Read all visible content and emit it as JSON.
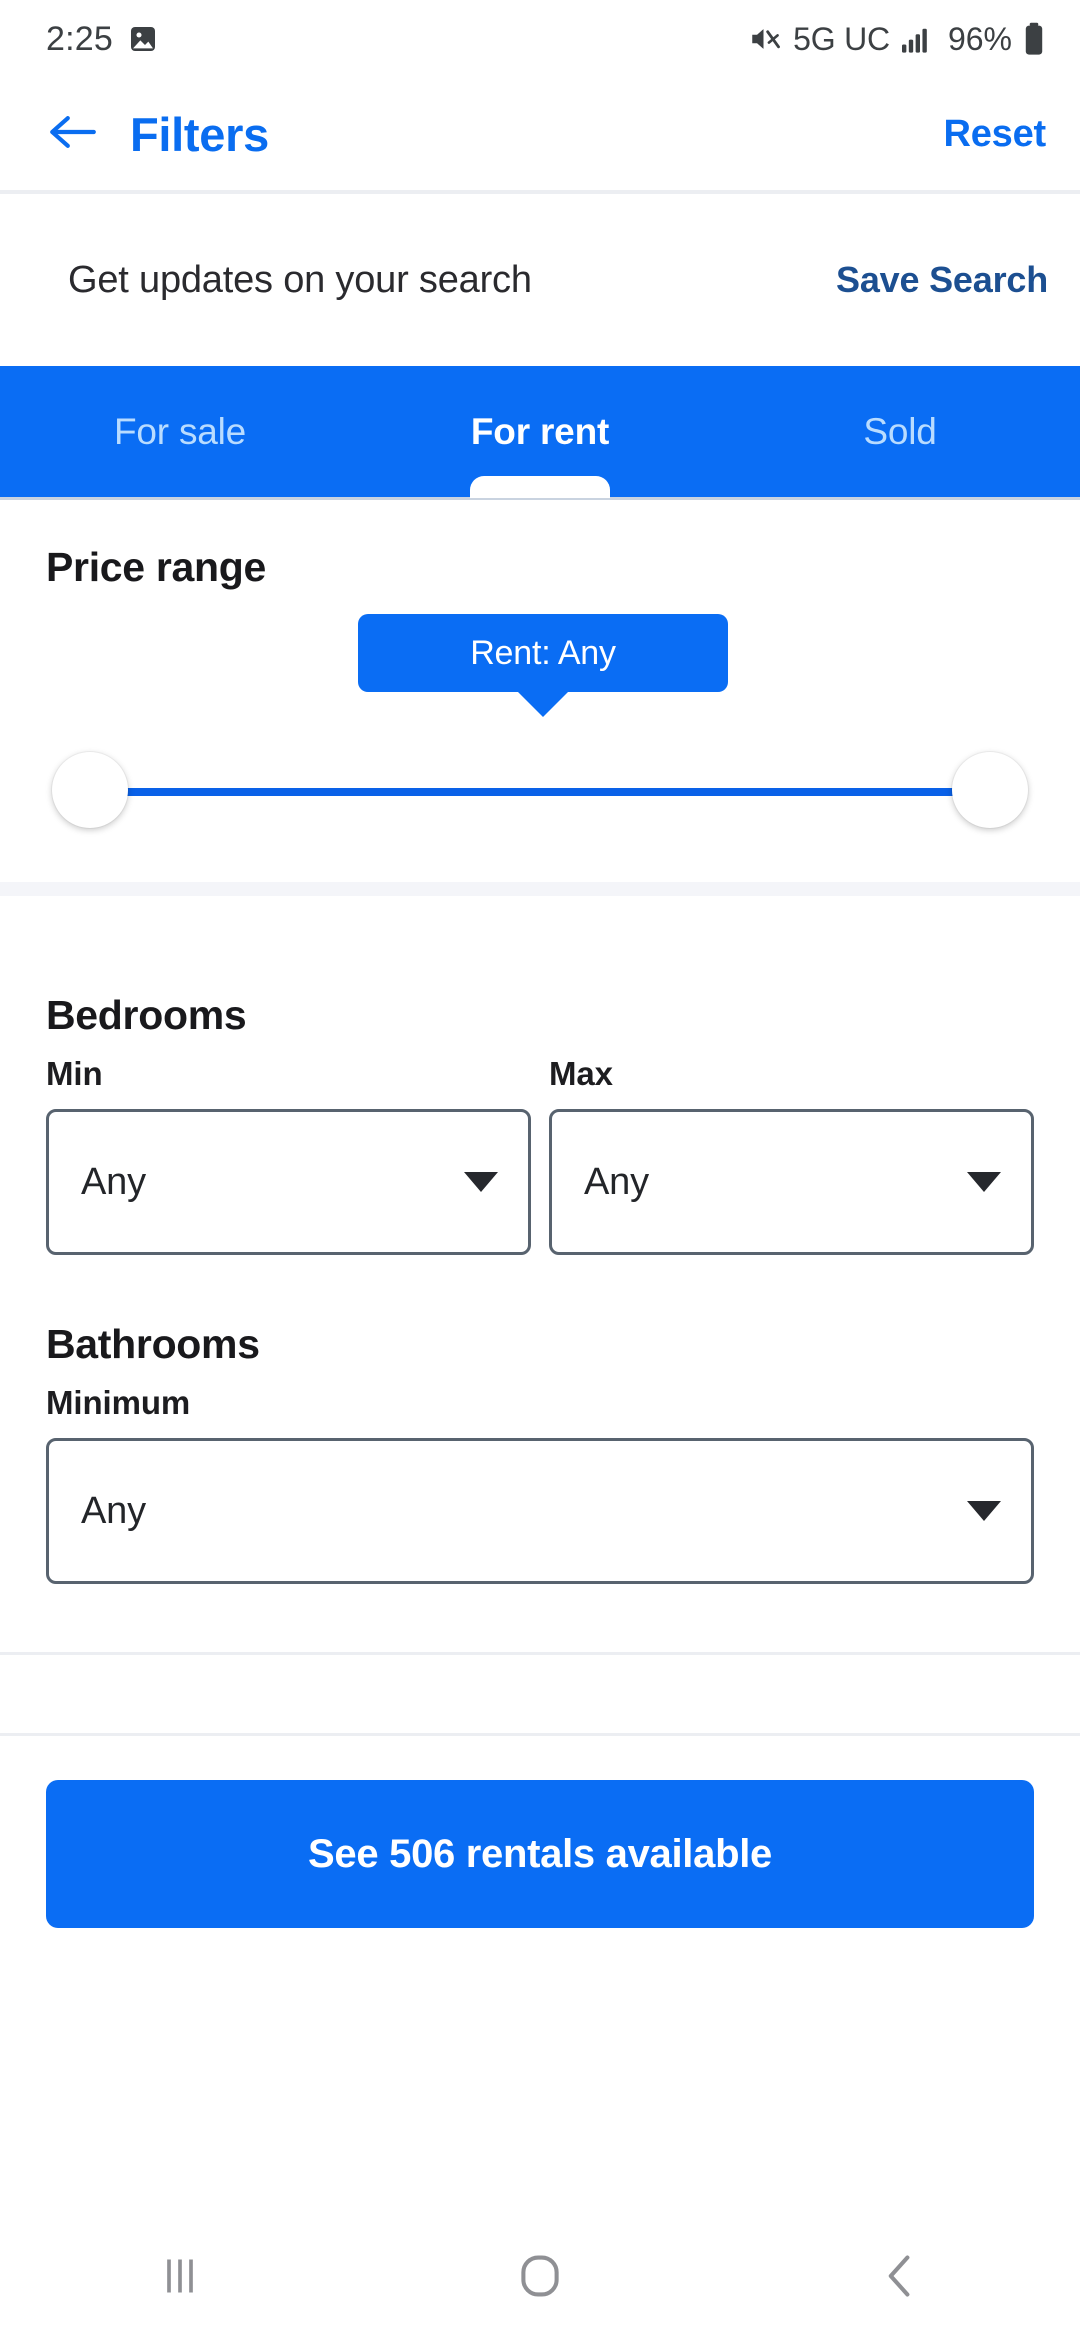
{
  "status_bar": {
    "time": "2:25",
    "screenshot_icon": "image-icon",
    "mute_icon": "mute-icon",
    "network_label": "5G UC",
    "signal_icon": "signal-bars-icon",
    "battery_percent": "96%",
    "battery_icon": "battery-full-icon"
  },
  "header": {
    "back_icon": "back-arrow-icon",
    "title": "Filters",
    "reset_label": "Reset"
  },
  "save_search": {
    "text": "Get updates on your search",
    "link_label": "Save Search"
  },
  "tabs": {
    "items": [
      {
        "label": "For sale",
        "active": false
      },
      {
        "label": "For rent",
        "active": true
      },
      {
        "label": "Sold",
        "active": false
      }
    ]
  },
  "price_range": {
    "title": "Price range",
    "tooltip_label": "Rent: Any",
    "min_thumb": "slider-min-handle",
    "max_thumb": "slider-max-handle"
  },
  "bedrooms": {
    "title": "Bedrooms",
    "min_label": "Min",
    "min_value": "Any",
    "max_label": "Max",
    "max_value": "Any"
  },
  "bathrooms": {
    "title": "Bathrooms",
    "minimum_label": "Minimum",
    "minimum_value": "Any"
  },
  "cta": {
    "label": "See 506 rentals available"
  },
  "nav_bar": {
    "recents_icon": "recents-icon",
    "home_icon": "home-icon",
    "back_icon": "back-chevron-icon"
  },
  "colors": {
    "primary_blue": "#0a6df4",
    "link_blue": "#0a6df0",
    "save_search_blue": "#1c4f91",
    "tab_inactive": "#b9dcff",
    "divider": "#eceef2",
    "band": "#f4f5f9",
    "select_border": "#58636f"
  }
}
